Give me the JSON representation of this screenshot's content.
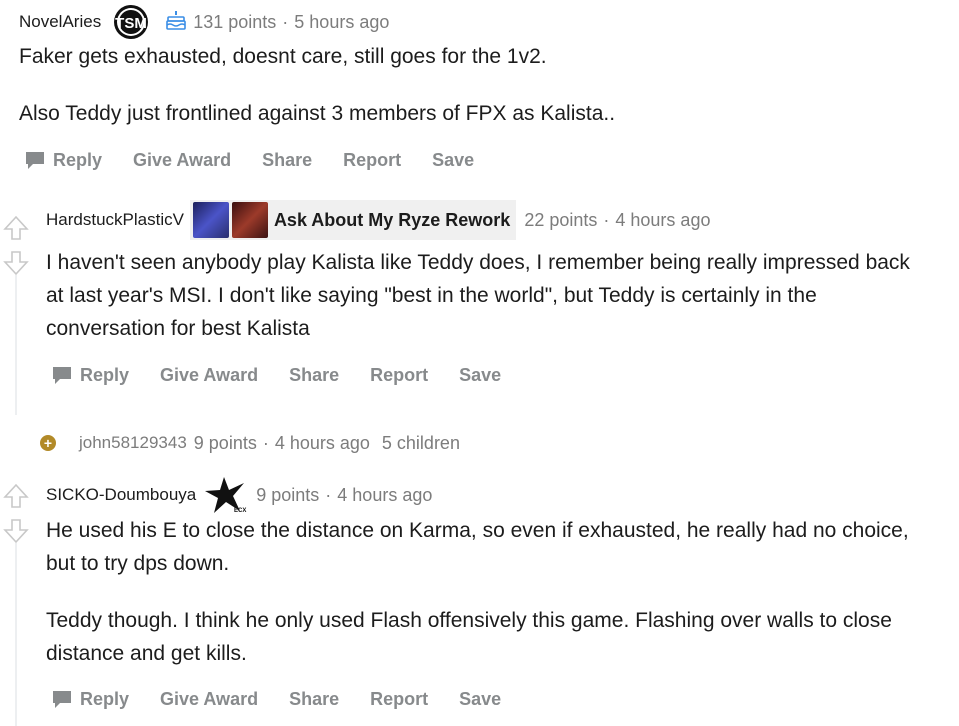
{
  "comments": [
    {
      "author": "NovelAries",
      "flair_icon": "tsm-logo-icon",
      "badge_icon": "cake-icon",
      "points": "131 points",
      "age": "5 hours ago",
      "paragraphs": [
        "Faker gets exhausted, doesnt care, still goes for the 1v2.",
        "Also Teddy just frontlined against 3 members of FPX as Kalista.."
      ]
    },
    {
      "author": "HardstuckPlasticV",
      "flair_text": "Ask About My Ryze Rework",
      "points": "22 points",
      "age": "4 hours ago",
      "paragraphs": [
        "I haven't seen anybody play Kalista like Teddy does, I remember being really impressed back at last year's MSI. I don't like saying \"best in the world\", but Teddy is certainly in the conversation for best Kalista"
      ]
    },
    {
      "author": "john58129343",
      "collapsed": true,
      "expand_symbol": "+",
      "points": "9 points",
      "age": "4 hours ago",
      "children": "5 children"
    },
    {
      "author": "SICKO-Doumbouya",
      "flair_icon": "ecx-logo-icon",
      "points": "9 points",
      "age": "4 hours ago",
      "paragraphs": [
        "He used his E to close the distance on Karma, so even if exhausted, he really had no choice, but to try dps down.",
        "Teddy though. I think he only used Flash offensively this game. Flashing over walls to close distance and get kills."
      ]
    }
  ],
  "actions": {
    "reply": "Reply",
    "give_award": "Give Award",
    "share": "Share",
    "report": "Report",
    "save": "Save"
  },
  "separator": "·",
  "colors": {
    "meta_gray": "#7c7c7c",
    "action_gray": "#878a8c",
    "expand_gold": "#b28a28",
    "vote_arrow": "#c8c8c8"
  }
}
